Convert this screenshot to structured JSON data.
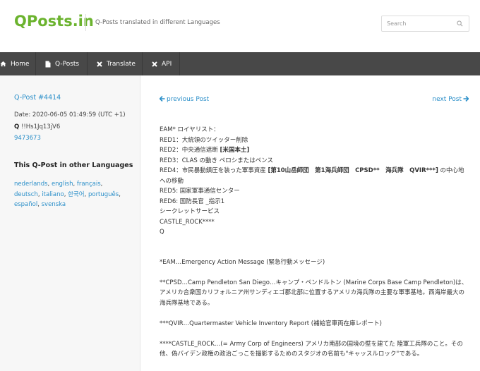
{
  "header": {
    "logo": "QPosts.in",
    "tagline": "Q-Posts translated in different Languages",
    "search_placeholder": "Search"
  },
  "nav": {
    "items": [
      {
        "label": "Home",
        "icon": "home-icon"
      },
      {
        "label": "Q-Posts",
        "icon": "document-icon"
      },
      {
        "label": "Translate",
        "icon": "x-icon"
      },
      {
        "label": "API",
        "icon": "x-icon"
      }
    ]
  },
  "sidebar": {
    "post_title": "Q-Post #4414",
    "date": "Date: 2020-06-05 01:49:59 (UTC +1)",
    "trip_name": "Q",
    "trip_code": "!!Hs1Jq13jV6",
    "post_id": "9473673",
    "languages_heading": "This Q-Post in other Languages",
    "languages": [
      "nederlands",
      "english",
      "français",
      "deutsch",
      "italiano",
      "한국어",
      "português",
      "español",
      "svenska"
    ]
  },
  "main": {
    "prev_label": "previous Post",
    "next_label": "next Post",
    "lines": {
      "l1": "EAM* ロイヤリスト：",
      "l2": "RED1：大統領のツイッター削除",
      "l3a": "RED2：中央通信遮断 ",
      "l3b": "[米国本土]",
      "l4": "RED3：CLAS の動き ペロシまたはペンス",
      "l5a": "RED4：市民暴動鎮圧を装った軍事資産 ",
      "l5b": "[第10山岳師団　第1海兵師団　CPSD**　海兵隊　QVIR***]",
      "l5c": " の中心地への移動",
      "l6": "RED5: 国家軍事通信センター",
      "l7": "RED6: 国防長官 _指示1",
      "l8": "シークレットサービス",
      "l9": "CASTLE_ROCK****",
      "l10": "Q",
      "n1": "*EAM…Emergency Action Message (緊急行動メッセージ)",
      "n2": "**CPSD…Camp Pendleton San Diego…キャンプ・ペンドルトン (Marine Corps Base Camp Pendleton)は、アメリカ合衆国カリフォルニア州サンディエゴ郡北部に位置するアメリカ海兵隊の主要な軍事基地。西海岸最大の海兵隊基地である。",
      "n3": "***QVIR…Quartermaster Vehicle Inventory Report (補給官車両在庫レポート)",
      "n4": "****CASTLE_ROCK…(= Army Corp of Engineers) アメリカ南部の国境の壁を建てた 陸軍工兵隊のこと。その他、偽バイデン政権の政治ごっこを撮影するためのスタジオの名前も\"キャッスルロック\"である。"
    }
  },
  "colors": {
    "logo": "#6bb32e",
    "link": "#2b8fc9",
    "nav_bg": "#484848",
    "sidebar_bg": "#f7f7f7"
  }
}
